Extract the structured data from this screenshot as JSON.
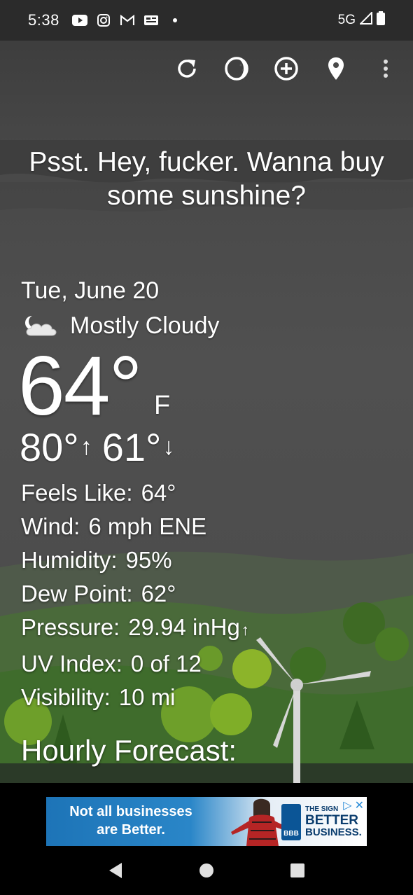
{
  "status_bar": {
    "time": "5:38",
    "network": "5G",
    "notification_icons": [
      "youtube-icon",
      "instagram-icon",
      "gmail-icon",
      "news-icon"
    ]
  },
  "toolbar": {
    "buttons": [
      "refresh-icon",
      "moon-icon",
      "add-location-icon",
      "location-pin-icon",
      "more-vert-icon"
    ]
  },
  "headline": "Psst. Hey, fucker. Wanna buy some sunshine?",
  "current": {
    "date": "Tue, June 20",
    "condition": "Mostly Cloudy",
    "condition_icon": "partly-cloudy-night-icon",
    "temperature": "64°",
    "unit": "F",
    "high": "80°",
    "low": "61°",
    "high_arrow": "↑",
    "low_arrow": "↓"
  },
  "details": {
    "feels_like_label": "Feels Like:",
    "feels_like_value": "64°",
    "wind_label": "Wind:",
    "wind_value": "6 mph ENE",
    "humidity_label": "Humidity:",
    "humidity_value": "95%",
    "dew_point_label": "Dew Point:",
    "dew_point_value": "62°",
    "pressure_label": "Pressure:",
    "pressure_value": "29.94 inHg",
    "pressure_trend": "↑",
    "uv_label": "UV Index:",
    "uv_value": "0 of 12",
    "visibility_label": "Visibility:",
    "visibility_value": "10 mi"
  },
  "hourly_title": "Hourly Forecast:",
  "ad": {
    "line1": "Not all businesses",
    "line2": "are Better.",
    "brand_small": "THE SIGN",
    "brand_big": "BETTER",
    "brand_big2": "BUSINESS.",
    "bbb": "BBB",
    "colors": {
      "blue": "#1d74b7",
      "navy": "#0b3d6e"
    }
  }
}
